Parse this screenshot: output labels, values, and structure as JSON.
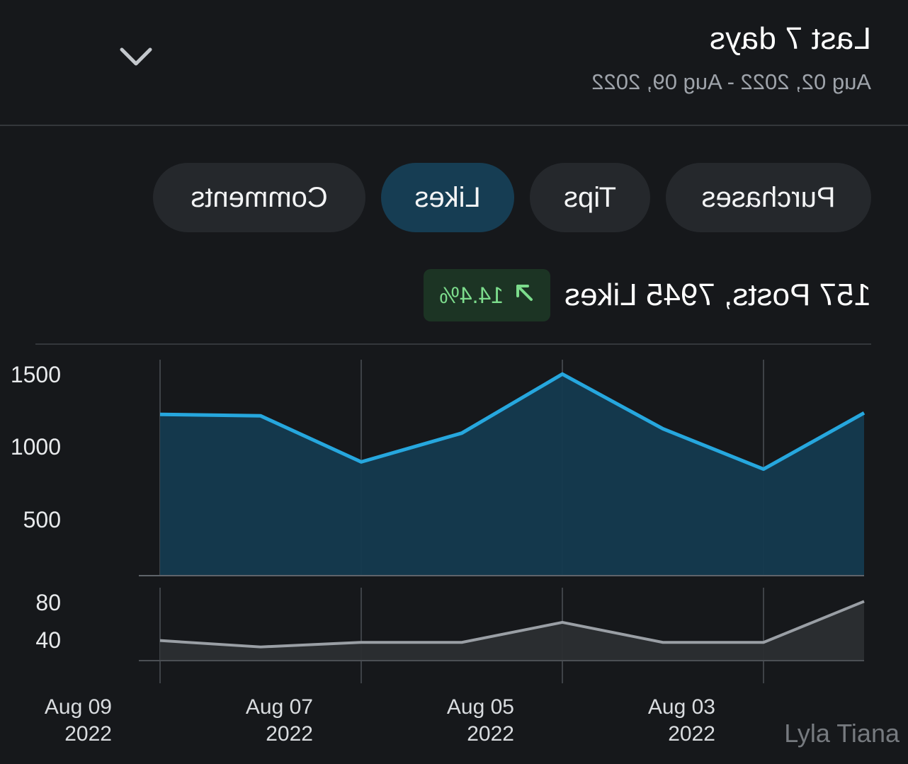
{
  "header": {
    "title": "Last 7 days",
    "date_range": "Aug 02, 2022 - Aug 09, 2022"
  },
  "tabs": [
    {
      "label": "Purchases",
      "active": false
    },
    {
      "label": "Tips",
      "active": false
    },
    {
      "label": "Likes",
      "active": true
    },
    {
      "label": "Comments",
      "active": false
    }
  ],
  "summary": {
    "text": "157 Posts, 7945 Likes",
    "delta": "14.4%",
    "delta_icon": "arrow-up-right-icon",
    "delta_color": "#7cdc8c"
  },
  "colors": {
    "accent": "#26a7de",
    "accent_fill": "#143a4f",
    "secondary": "#9a9fa5",
    "active_tab": "#163d53"
  },
  "chart_data": [
    {
      "type": "area",
      "series": [
        {
          "values": [
            1130,
            740,
            1020,
            1400,
            990,
            790,
            1110,
            1120
          ]
        }
      ],
      "x_ticks": [
        "Aug 03\n2022",
        "Aug 05\n2022",
        "Aug 07\n2022",
        "Aug 09\n2022"
      ],
      "y_ticks": [
        "1500",
        "1000",
        "500"
      ],
      "ylim": [
        0,
        1500
      ]
    },
    {
      "type": "area",
      "series": [
        {
          "values": [
            65,
            20,
            20,
            42,
            20,
            20,
            15,
            22
          ]
        }
      ],
      "y_ticks": [
        "80",
        "40"
      ],
      "ylim": [
        0,
        80
      ]
    }
  ],
  "watermark": "Lyla Tiana"
}
